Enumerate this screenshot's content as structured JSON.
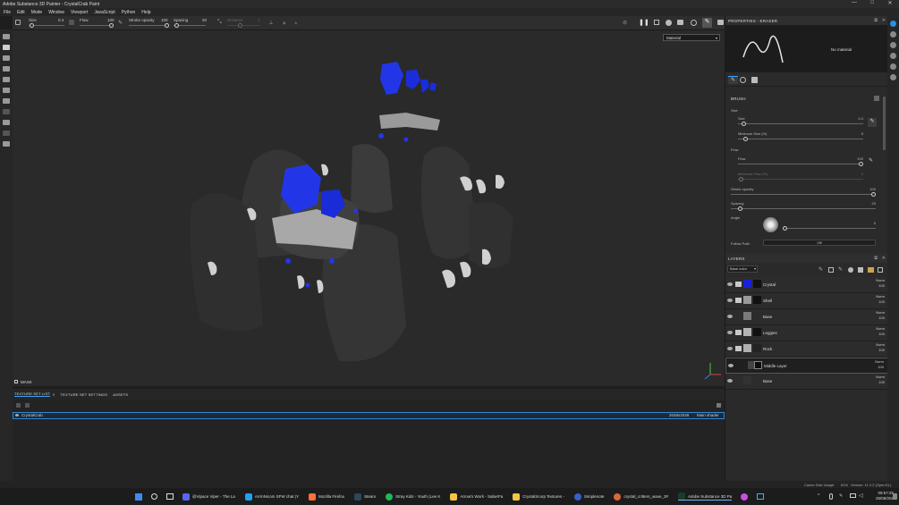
{
  "window": {
    "title": "Adobe Substance 3D Painter - CrystalCrab Paint",
    "minimize": "—",
    "maximize": "□",
    "close": "✕"
  },
  "menu": [
    "File",
    "Edit",
    "Mode",
    "Window",
    "Viewport",
    "JavaScript",
    "Python",
    "Help"
  ],
  "toolbar": {
    "size_label": "Size",
    "size_value": "0.4",
    "flow_label": "Flow",
    "flow_value": "100",
    "stroke_opacity_label": "Stroke opacity",
    "stroke_opacity_value": "100",
    "spacing_label": "Spacing",
    "spacing_value": "20",
    "distance_label": "Distance",
    "distance_value": "1"
  },
  "viewport": {
    "material_mode": "Material",
    "mask_label": "MASK"
  },
  "texture_set": {
    "tabs": [
      "TEXTURE SET LIST",
      "TEXTURE SET SETTINGS",
      "ASSETS"
    ],
    "close_glyph": "✕",
    "row": {
      "name": "CrystalCrab",
      "resolution": "2048x2048",
      "shader": "Main shader"
    }
  },
  "properties": {
    "title": "PROPERTIES - ERASER",
    "no_material": "No material",
    "brush_section": "BRUSH",
    "size_group": "Size",
    "size_label": "Size",
    "size_value": "0.4",
    "min_size_label": "Minimum Size (%)",
    "min_size_value": "5",
    "flow_group": "Flow",
    "flow_label": "Flow",
    "flow_value": "100",
    "min_flow_label": "Minimum Flow (%)",
    "min_flow_value": "0",
    "stroke_opacity_label": "Stroke opacity",
    "stroke_opacity_value": "100",
    "spacing_label": "Spacing",
    "spacing_value": "20",
    "angle_label": "Angle",
    "angle_value": "0",
    "follow_path_label": "Follow Path",
    "follow_path_value": "Off"
  },
  "layers": {
    "title": "LAYERS",
    "channel": "Base color",
    "rows": [
      {
        "name": "Crystal",
        "blend": "Norm",
        "opacity": "100",
        "color": "#1a22d6"
      },
      {
        "name": "Shell",
        "blend": "Norm",
        "opacity": "100",
        "color": "#9a9a9a"
      },
      {
        "name": "Base",
        "blend": "Norm",
        "opacity": "100",
        "color": "#7a7a7a"
      },
      {
        "name": "Leggies",
        "blend": "Norm",
        "opacity": "100",
        "color": "#b5b5b5"
      },
      {
        "name": "Rock",
        "blend": "Norm",
        "opacity": "100",
        "color": "#b0b0b0"
      },
      {
        "name": "Middle Layer",
        "blend": "Norm",
        "opacity": "100",
        "color": "#444444"
      },
      {
        "name": "Base",
        "blend": "Norm",
        "opacity": "100",
        "color": "#333333"
      }
    ]
  },
  "status": {
    "cache": "Cache Disk Usage:",
    "cache_value": "81%",
    "version": "Version: 11.0.2 (OpenGL)"
  },
  "taskbar": {
    "items": [
      {
        "label": "@Vipace Viper - The La",
        "color": "#5865f2"
      },
      {
        "label": "ArrmNicom SFW chat (Y",
        "color": "#1da1f2"
      },
      {
        "label": "Mozilla Firefox",
        "color": "#ff7139"
      },
      {
        "label": "Steam",
        "color": "#2a475e"
      },
      {
        "label": "Stray Kids - Youth (Lee K",
        "color": "#1db954"
      },
      {
        "label": "Arrow's Work - SaberFa",
        "color": "#f4c542"
      },
      {
        "label": "CrystalScorp Textures -",
        "color": "#f4c542"
      },
      {
        "label": "Simplenote",
        "color": "#3361cc"
      },
      {
        "label": "crystal_critters_wave_3#",
        "color": "#d9663c"
      },
      {
        "label": "Adobe Substance 3D Pa",
        "color": "#163f27"
      }
    ],
    "time": "09:57:25",
    "date": "25/08/2026"
  }
}
